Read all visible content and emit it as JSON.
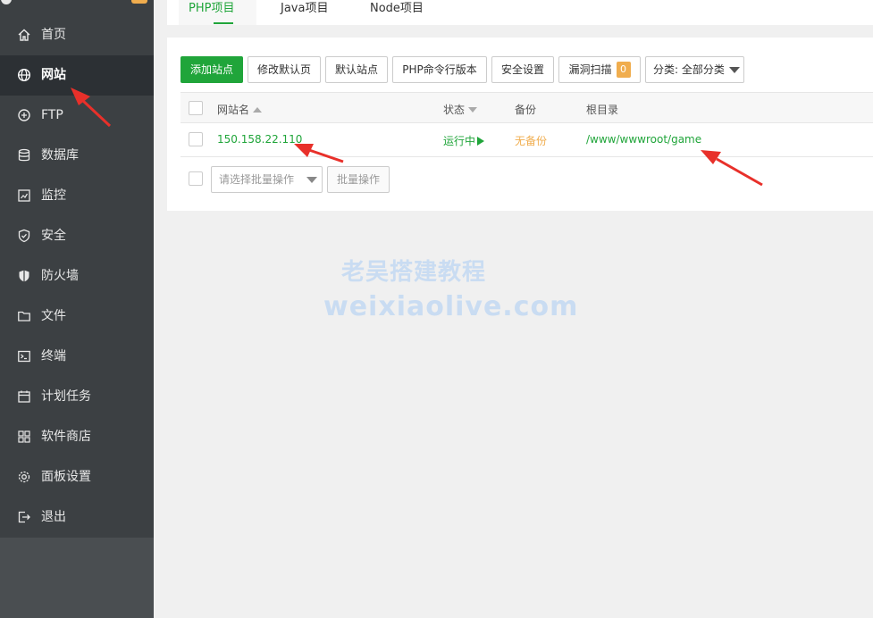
{
  "sidebar": {
    "items": [
      {
        "label": "首页",
        "icon": "home-icon"
      },
      {
        "label": "网站",
        "icon": "globe-icon"
      },
      {
        "label": "FTP",
        "icon": "ftp-icon"
      },
      {
        "label": "数据库",
        "icon": "database-icon"
      },
      {
        "label": "监控",
        "icon": "monitor-icon"
      },
      {
        "label": "安全",
        "icon": "shield-icon"
      },
      {
        "label": "防火墙",
        "icon": "firewall-icon"
      },
      {
        "label": "文件",
        "icon": "folder-icon"
      },
      {
        "label": "终端",
        "icon": "terminal-icon"
      },
      {
        "label": "计划任务",
        "icon": "calendar-icon"
      },
      {
        "label": "软件商店",
        "icon": "apps-grid-icon"
      },
      {
        "label": "面板设置",
        "icon": "gear-icon"
      },
      {
        "label": "退出",
        "icon": "logout-icon"
      }
    ],
    "active_index": 1
  },
  "tabs": [
    {
      "label": "PHP项目",
      "active": true
    },
    {
      "label": "Java项目",
      "active": false
    },
    {
      "label": "Node项目",
      "active": false
    }
  ],
  "toolbar": {
    "add_site": "添加站点",
    "edit_default_page": "修改默认页",
    "default_site": "默认站点",
    "php_cli_version": "PHP命令行版本",
    "security_settings": "安全设置",
    "vuln_scan": "漏洞扫描",
    "vuln_count": "0",
    "category_select": "分类: 全部分类"
  },
  "table": {
    "columns": {
      "site_name": "网站名",
      "status": "状态",
      "backup": "备份",
      "root_dir": "根目录"
    },
    "rows": [
      {
        "site_name": "150.158.22.110",
        "status": "运行中",
        "backup": "无备份",
        "root_dir": "/www/wwwroot/game"
      }
    ]
  },
  "batch": {
    "placeholder": "请选择批量操作",
    "button": "批量操作"
  },
  "watermark": {
    "line1": "老吴搭建教程",
    "line2": "weixiaolive.com"
  },
  "colors": {
    "accent": "#20a53a",
    "warning": "#f0ad4e",
    "sidebar_bg": "#3c4043",
    "sidebar_active": "#2c3034",
    "annotation_arrow": "#e8302a"
  }
}
